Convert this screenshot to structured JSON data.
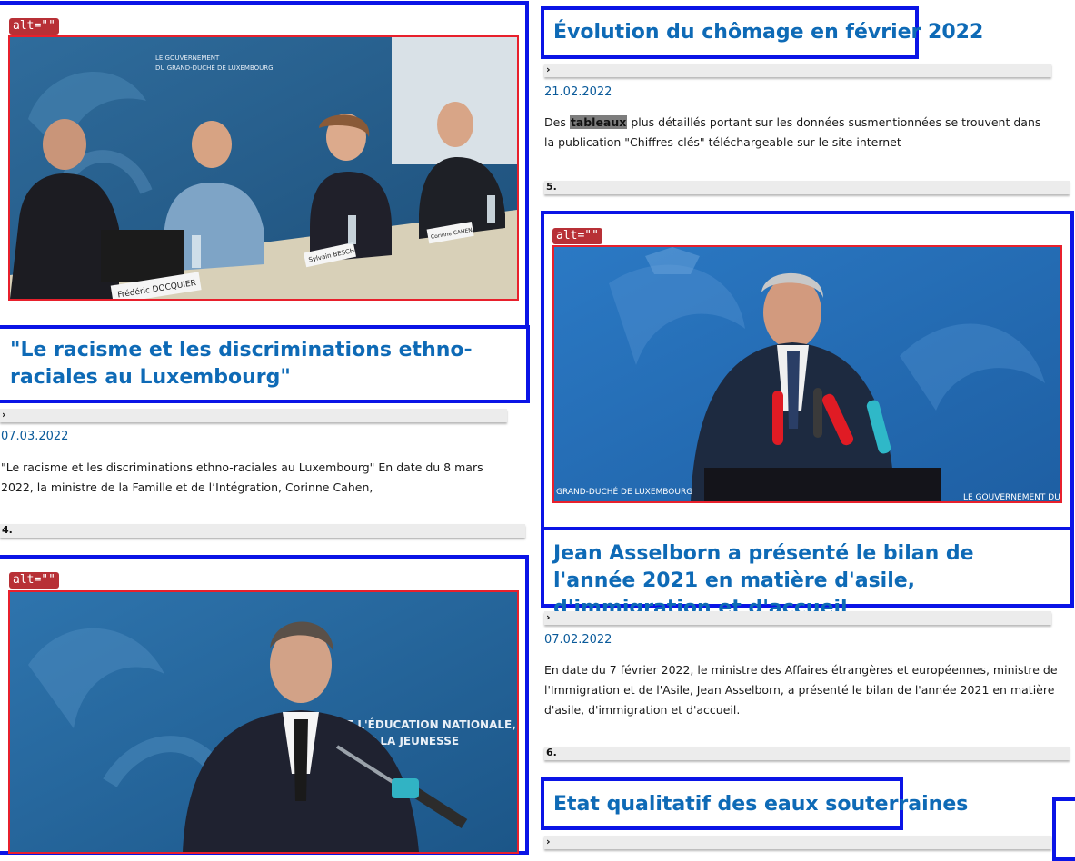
{
  "alt_badge": "alt=\"\"",
  "articles": [
    {
      "title": "\"Le racisme et les discriminations ethno-raciales au Luxembourg\"",
      "toggle": "›",
      "date": "07.03.2022",
      "excerpt": "\"Le racisme et les discriminations ethno-raciales au Luxembourg\" En date du 8 mars 2022, la ministre de la Famille et de l’Intégration, Corinne Cahen,",
      "number": "4."
    },
    {
      "title": "Évolution du chômage en février 2022",
      "toggle": "›",
      "date": "21.02.2022",
      "excerpt_before": "Des ",
      "excerpt_highlight": "tableaux",
      "excerpt_after": " plus détaillés portant sur les données susmentionnées se trouvent dans la publication \"Chiffres-clés\" téléchargeable sur le site internet",
      "number": "5."
    },
    {
      "title": "Jean Asselborn a présenté le bilan de l'année 2021 en matière d'asile, d'immigration et d'accueil",
      "toggle": "›",
      "date": "07.02.2022",
      "excerpt": "En date du 7 février 2022, le ministre des Affaires étrangères et européennes, ministre de l'Immigration et de l'Asile, Jean Asselborn, a présenté le bilan de l'année 2021 en matière d'asile, d'immigration et d'accueil.",
      "number": "6."
    },
    {
      "title": "Etat qualitatif des eaux souterraines",
      "toggle": "›"
    }
  ],
  "photos": {
    "photo1": {
      "backdrop_line1": "LE GOUVERNEMENT",
      "backdrop_line2": "DU GRAND-DUCHÉ DE LUXEMBOURG",
      "nameplate1": "Frédéric DOCQUIER",
      "nameplate2": "Sylvain BESCH",
      "nameplate3": "Corinne CAHEN"
    },
    "photo2": {
      "left_caption": "GRAND-DUCHÉ DE LUXEMBOURG",
      "right_caption": "LE GOUVERNEMENT DU"
    },
    "photo3": {
      "line1": "DE L'ÉDUCATION NATIONALE,",
      "line2": "DE LA JEUNESSE"
    }
  },
  "colors": {
    "annotation_blue": "#0a14e6",
    "image_red": "#e8202c",
    "title_blue": "#0e6ab6",
    "badge_red": "#b83036"
  }
}
